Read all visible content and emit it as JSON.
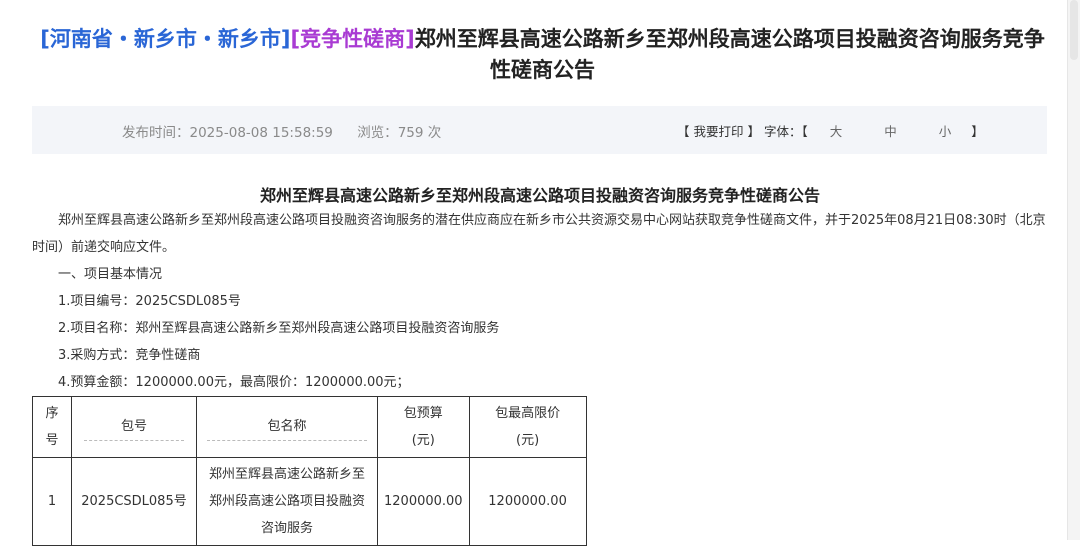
{
  "header": {
    "region": "[河南省・新乡市・新乡市]",
    "method": "[竞争性磋商]",
    "title": "郑州至辉县高速公路新乡至郑州段高速公路项目投融资咨询服务竞争性磋商公告"
  },
  "meta": {
    "publish_label": "发布时间：",
    "publish_time": "2025-08-08 15:58:59",
    "views_label": "浏览：",
    "views_count": "759",
    "views_unit": "次",
    "print_label": "【 我要打印 】",
    "font_label": "字体：",
    "font_open": "【",
    "font_large": "大",
    "font_medium": "中",
    "font_small": "小",
    "font_close": "】"
  },
  "document": {
    "heading": "郑州至辉县高速公路新乡至郑州段高速公路项目投融资咨询服务竞争性磋商公告",
    "intro": "郑州至辉县高速公路新乡至郑州段高速公路项目投融资咨询服务的潜在供应商应在新乡市公共资源交易中心网站获取竞争性磋商文件，并于2025年08月21日08:30时（北京时间）前递交响应文件。",
    "section1": "一、项目基本情况",
    "item1": "1.项目编号：2025CSDL085号",
    "item2": "2.项目名称：郑州至辉县高速公路新乡至郑州段高速公路项目投融资咨询服务",
    "item3": "3.采购方式：竞争性磋商",
    "item4": "4.预算金额：1200000.00元，最高限价：1200000.00元；"
  },
  "package_table": {
    "headers": {
      "seq_1": "序",
      "seq_2": "号",
      "pkg_no": "包号",
      "pkg_name": "包名称",
      "budget_1": "包预算",
      "budget_2": "(元)",
      "max_1": "包最高限价",
      "max_2": "(元)"
    },
    "rows": [
      {
        "seq": "1",
        "pkg_no": "2025CSDL085号",
        "pkg_name_1": "郑州至辉县高速公路新乡至",
        "pkg_name_2": "郑州段高速公路项目投融资",
        "pkg_name_3": "咨询服务",
        "budget": "1200000.00",
        "max_price": "1200000.00"
      }
    ]
  }
}
